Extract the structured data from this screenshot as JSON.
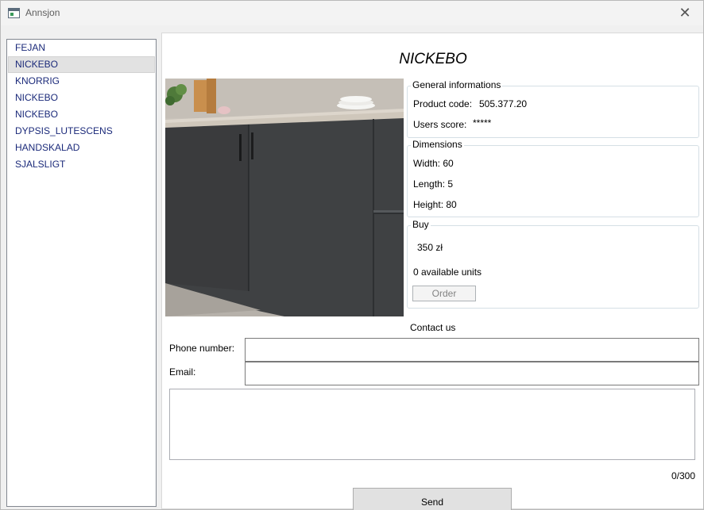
{
  "window": {
    "title": "Annsjon",
    "close_glyph": "✕"
  },
  "product_list": {
    "selected_index": 1,
    "items": [
      {
        "label": "FEJAN"
      },
      {
        "label": "NICKEBO"
      },
      {
        "label": "KNORRIG"
      },
      {
        "label": "NICKEBO"
      },
      {
        "label": "NICKEBO"
      },
      {
        "label": "DYPSIS_LUTESCENS"
      },
      {
        "label": "HANDSKALAD"
      },
      {
        "label": "SJALSLIGT"
      }
    ]
  },
  "product": {
    "name": "NICKEBO",
    "general": {
      "legend": "General informations",
      "code_label": "Product code:",
      "code_value": "505.377.20",
      "score_label": "Users score:",
      "score_value": "*****"
    },
    "dimensions": {
      "legend": "Dimensions",
      "width": "Width: 60",
      "length": "Length: 5",
      "height": "Height: 80"
    },
    "buy": {
      "legend": "Buy",
      "price": "350 zł",
      "availability": "0 available units",
      "order_label": "Order"
    }
  },
  "contact": {
    "title": "Contact us",
    "phone_label": "Phone number:",
    "phone_value": "",
    "email_label": "Email:",
    "email_value": "",
    "message_value": "",
    "char_count": "0/300",
    "send_label": "Send"
  }
}
